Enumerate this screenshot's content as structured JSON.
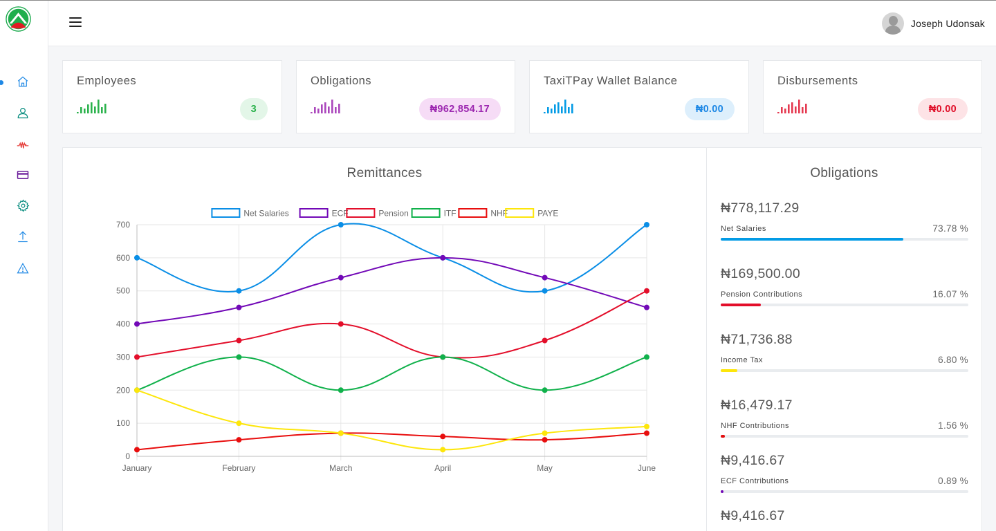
{
  "header": {
    "user_name": "Joseph Udonsak"
  },
  "sidebar": {
    "items": [
      {
        "icon": "home-icon",
        "color": "#1e88e5",
        "active": true
      },
      {
        "icon": "user-icon",
        "color": "#00897b"
      },
      {
        "icon": "naira-pulse-icon",
        "color": "#e53935"
      },
      {
        "icon": "credit-card-icon",
        "color": "#6a1b9a"
      },
      {
        "icon": "gear-icon",
        "color": "#00897b"
      },
      {
        "icon": "upload-icon",
        "color": "#1e88e5"
      },
      {
        "icon": "warning-icon",
        "color": "#1e88e5"
      }
    ]
  },
  "stats": [
    {
      "title": "Employees",
      "value": "3",
      "color": "#2bb24c",
      "bg": "#e3f6e8",
      "text": "#2bb24c"
    },
    {
      "title": "Obligations",
      "value": "₦962,854.17",
      "color": "#ab47bc",
      "bg": "#f6dcf6",
      "text": "#9c27b0"
    },
    {
      "title": "TaxiTPay Wallet Balance",
      "value": "₦0.00",
      "color": "#039be5",
      "bg": "#ddeffc",
      "text": "#1e88e5"
    },
    {
      "title": "Disbursements",
      "value": "₦0.00",
      "color": "#e53950",
      "bg": "#fde3e6",
      "text": "#e0102a"
    }
  ],
  "chart_title": "Remittances",
  "chart_data": {
    "type": "line",
    "categories": [
      "January",
      "February",
      "March",
      "April",
      "May",
      "June"
    ],
    "ylim": [
      0,
      700
    ],
    "yticks": [
      0,
      100,
      200,
      300,
      400,
      500,
      600,
      700
    ],
    "grid": true,
    "legend_position": "top",
    "series": [
      {
        "name": "Net Salaries",
        "color": "#0a8ee6",
        "values": [
          600,
          500,
          700,
          600,
          500,
          700
        ]
      },
      {
        "name": "ECF",
        "color": "#7209b7",
        "values": [
          400,
          450,
          540,
          600,
          540,
          450
        ]
      },
      {
        "name": "Pension",
        "color": "#e30e2a",
        "values": [
          300,
          350,
          400,
          300,
          350,
          500
        ]
      },
      {
        "name": "ITF",
        "color": "#10b14b",
        "values": [
          200,
          300,
          200,
          300,
          200,
          300
        ]
      },
      {
        "name": "NHF",
        "color": "#e80e0e",
        "values": [
          20,
          50,
          70,
          60,
          50,
          70
        ]
      },
      {
        "name": "PAYE",
        "color": "#fde60b",
        "values": [
          200,
          100,
          70,
          20,
          70,
          90
        ]
      }
    ]
  },
  "obligations_title": "Obligations",
  "obligations": [
    {
      "amount": "₦778,117.29",
      "label": "Net Salaries",
      "percent": "73.78 %",
      "fraction": 0.7378,
      "color": "#039be5"
    },
    {
      "amount": "₦169,500.00",
      "label": "Pension Contributions",
      "percent": "16.07 %",
      "fraction": 0.1607,
      "color": "#e30e2a"
    },
    {
      "amount": "₦71,736.88",
      "label": "Income Tax",
      "percent": "6.80 %",
      "fraction": 0.068,
      "color": "#fde60b"
    },
    {
      "amount": "₦16,479.17",
      "label": "NHF Contributions",
      "percent": "1.56 %",
      "fraction": 0.0156,
      "color": "#e30e0e"
    },
    {
      "amount": "₦9,416.67",
      "label": "ECF Contributions",
      "percent": "0.89 %",
      "fraction": 0.0089,
      "color": "#7209b7"
    },
    {
      "amount": "₦9,416.67",
      "label": "",
      "percent": "",
      "fraction": 0,
      "color": "#10b14b"
    }
  ]
}
